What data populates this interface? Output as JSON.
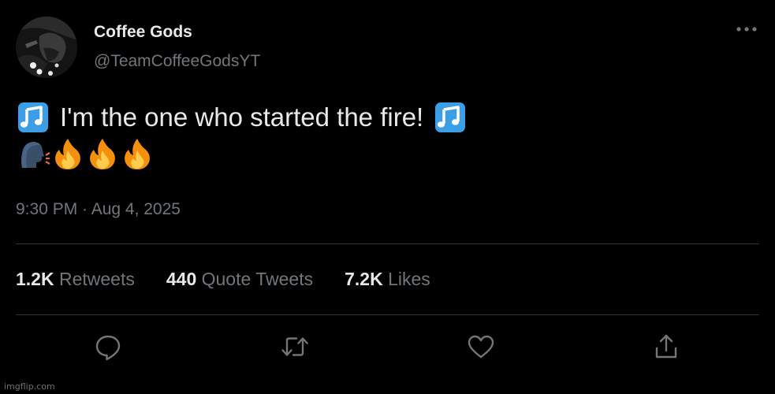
{
  "tweet": {
    "display_name": "Coffee Gods",
    "handle": "@TeamCoffeeGodsYT",
    "text_line1": "I'm the one who started the fire!",
    "emojis_line1": [
      "musical-notes",
      "musical-notes"
    ],
    "emojis_line2": [
      "speaking-head",
      "fire",
      "fire",
      "fire"
    ],
    "timestamp": "9:30 PM · Aug 4, 2025"
  },
  "stats": [
    {
      "count": "1.2K",
      "label": "Retweets"
    },
    {
      "count": "440",
      "label": "Quote Tweets"
    },
    {
      "count": "7.2K",
      "label": "Likes"
    }
  ],
  "actions": [
    "reply-icon",
    "retweet-icon",
    "like-icon",
    "share-icon"
  ],
  "watermark": "imgflip.com",
  "colors": {
    "background": "#000000",
    "primary_text": "#e7e9ea",
    "secondary_text": "#71767b",
    "divider": "#2f3336",
    "note_blue": "#3b9ee6"
  }
}
